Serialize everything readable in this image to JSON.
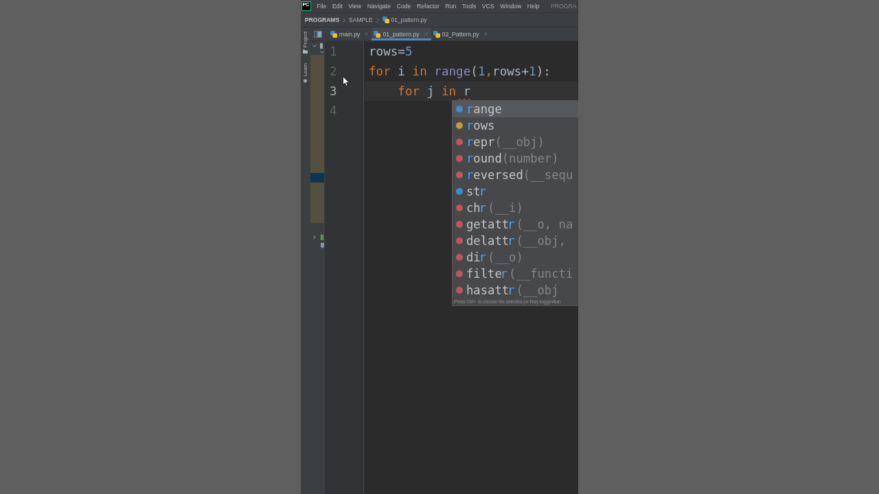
{
  "menu_bar": {
    "logo": "PC",
    "items": [
      "File",
      "Edit",
      "View",
      "Navigate",
      "Code",
      "Refactor",
      "Run",
      "Tools",
      "VCS",
      "Window",
      "Help"
    ],
    "project": "PROGRA"
  },
  "breadcrumbs": [
    {
      "label": "PROGRAMS",
      "kind": "project"
    },
    {
      "label": "SAMPLE",
      "kind": "folder"
    },
    {
      "label": "01_pattern.py",
      "kind": "file"
    }
  ],
  "tool_windows": [
    {
      "label": "Project",
      "kind": "project"
    },
    {
      "label": "Learn",
      "kind": "learn"
    }
  ],
  "tabs": [
    {
      "label": "main.py",
      "selected": false
    },
    {
      "label": "01_pattern.py",
      "selected": true
    },
    {
      "label": "02_Pattern.py",
      "selected": false
    }
  ],
  "editor": {
    "lines": [
      {
        "number": "1",
        "current": false,
        "tokens": [
          {
            "text": "rows=",
            "kind": "plain"
          },
          {
            "text": "5",
            "kind": "number"
          }
        ]
      },
      {
        "number": "2",
        "current": false,
        "tokens": [
          {
            "text": "for",
            "kind": "keyword"
          },
          {
            "text": " i ",
            "kind": "plain"
          },
          {
            "text": "in",
            "kind": "keyword"
          },
          {
            "text": " range",
            "kind": "builtin"
          },
          {
            "text": "(",
            "kind": "plain"
          },
          {
            "text": "1",
            "kind": "number"
          },
          {
            "text": ",",
            "kind": "keyword"
          },
          {
            "text": "rows+",
            "kind": "plain"
          },
          {
            "text": "1",
            "kind": "number"
          },
          {
            "text": "):",
            "kind": "plain"
          }
        ]
      },
      {
        "number": "3",
        "current": true,
        "tokens": [
          {
            "text": "    for",
            "kind": "keyword"
          },
          {
            "text": " j ",
            "kind": "plain"
          },
          {
            "text": "in",
            "kind": "keyword"
          },
          {
            "text": " r",
            "kind": "plain",
            "error": true
          }
        ]
      },
      {
        "number": "4",
        "current": false
      }
    ]
  },
  "completion": {
    "items": [
      {
        "kind": "class",
        "selected": true,
        "match": "r",
        "rest": "ange"
      },
      {
        "kind": "variable",
        "selected": false,
        "match": "r",
        "rest": "ows"
      },
      {
        "kind": "function",
        "selected": false,
        "match": "r",
        "rest": "epr",
        "params": "(__obj)"
      },
      {
        "kind": "function",
        "selected": false,
        "match": "r",
        "rest": "ound",
        "params": "(number)"
      },
      {
        "kind": "function",
        "selected": false,
        "match": "r",
        "rest": "eversed",
        "params": "(__sequ"
      },
      {
        "kind": "class",
        "selected": false,
        "lead": "st",
        "match": "r"
      },
      {
        "kind": "function",
        "selected": false,
        "lead": "ch",
        "match": "r",
        "params": "(__i)"
      },
      {
        "kind": "function",
        "selected": false,
        "lead": "getatt",
        "match": "r",
        "params": "(__o, na"
      },
      {
        "kind": "function",
        "selected": false,
        "lead": "delatt",
        "match": "r",
        "params": "(__obj,"
      },
      {
        "kind": "function",
        "selected": false,
        "lead": "di",
        "match": "r",
        "params": "(__o)"
      },
      {
        "kind": "function",
        "selected": false,
        "lead": "filte",
        "match": "r",
        "params": "(__functi"
      },
      {
        "kind": "function",
        "selected": false,
        "lead": "hasatt",
        "match": "r",
        "params": "(__obj"
      }
    ],
    "hint": "Press Ctrl+. to choose the selected (or first) suggestion"
  }
}
